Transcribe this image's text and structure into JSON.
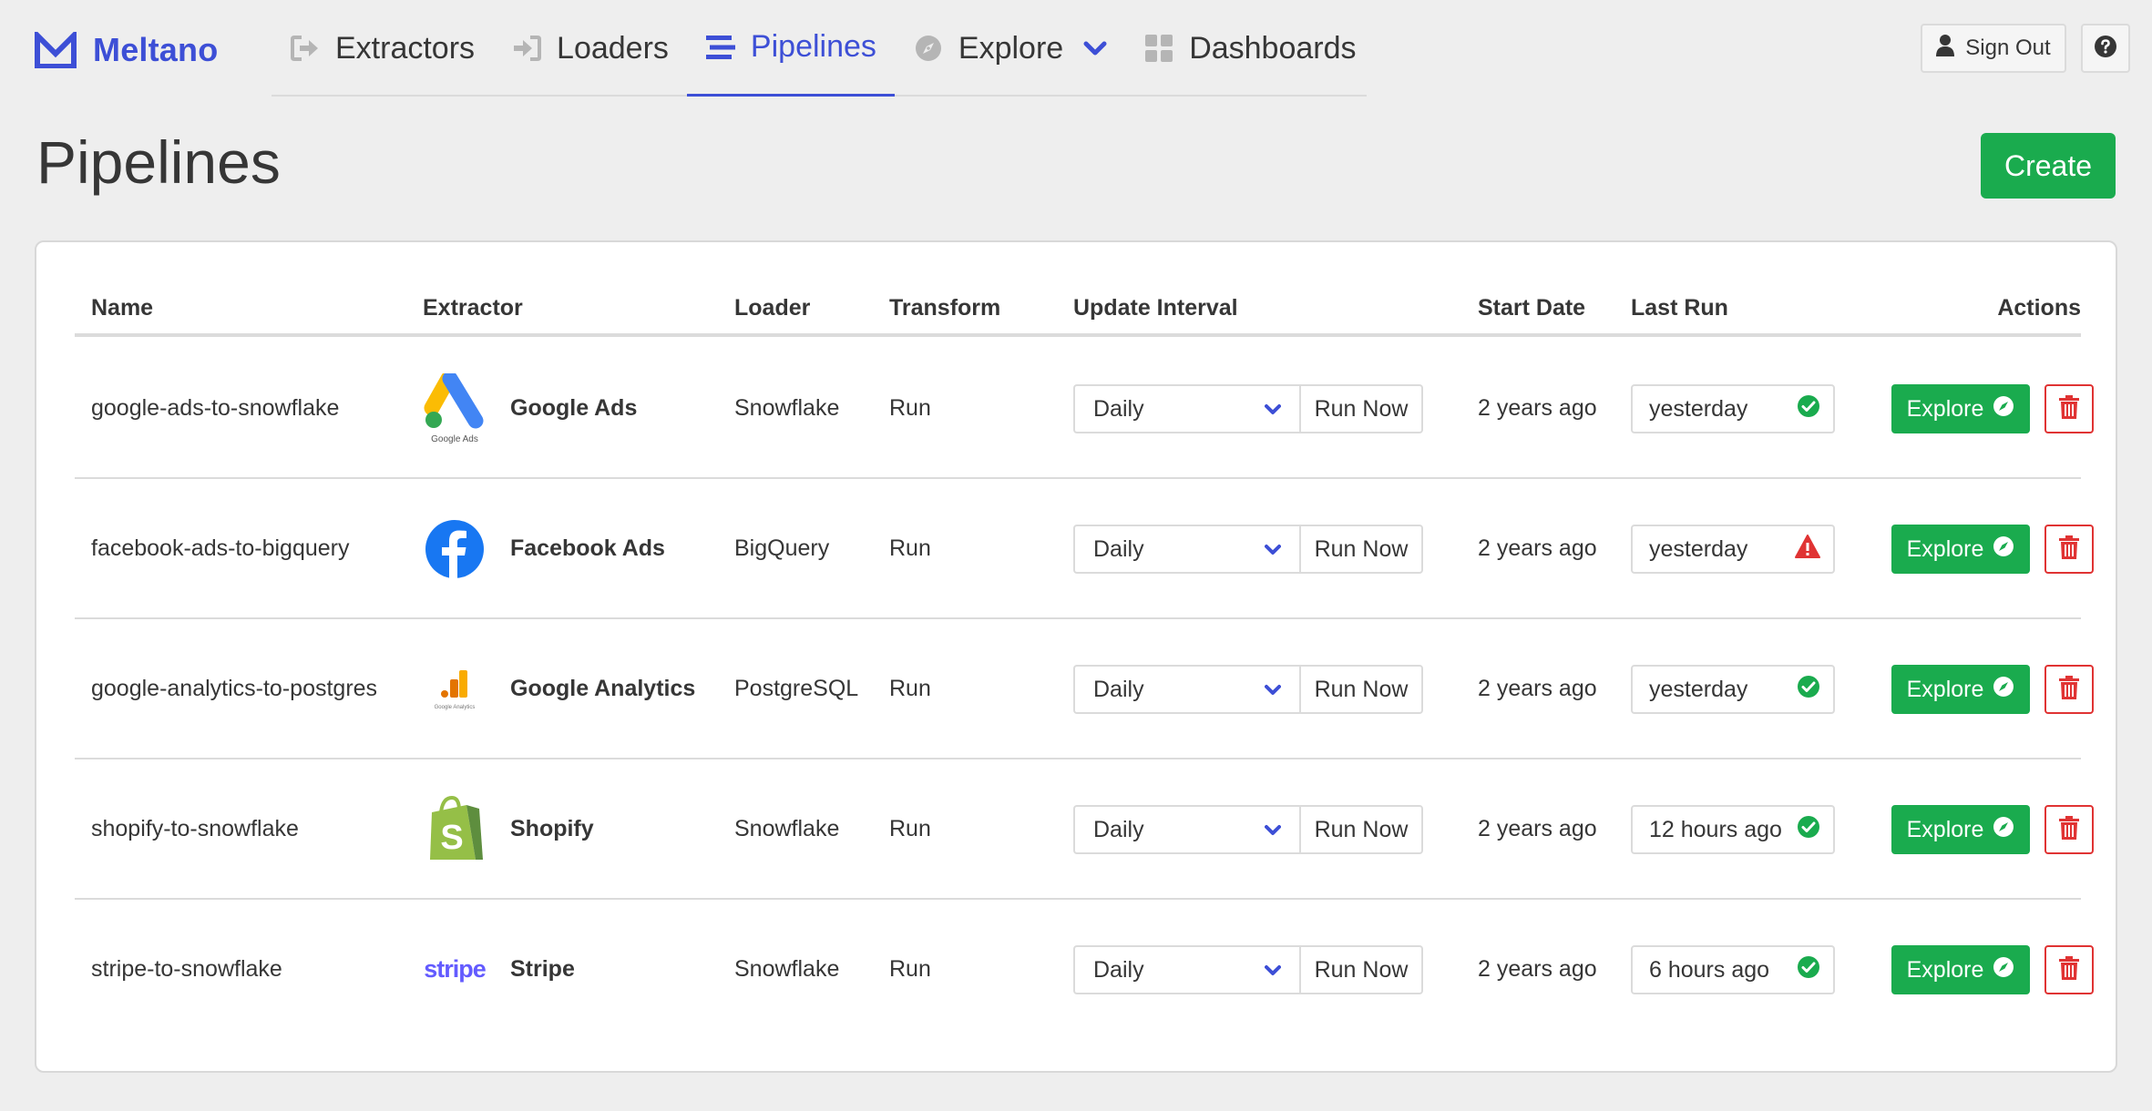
{
  "brand": {
    "name": "Meltano",
    "color": "#3d4fd6"
  },
  "nav": {
    "tabs": [
      {
        "label": "Extractors",
        "icon": "sign-out-icon"
      },
      {
        "label": "Loaders",
        "icon": "sign-in-icon"
      },
      {
        "label": "Pipelines",
        "icon": "stream-icon",
        "active": true
      },
      {
        "label": "Explore",
        "icon": "compass-icon"
      },
      {
        "label": "Dashboards",
        "icon": "th-large-icon"
      }
    ],
    "sign_out": "Sign Out",
    "help_icon": "question-circle-icon"
  },
  "header": {
    "title": "Pipelines",
    "create_label": "Create",
    "create_color": "#1aab4e"
  },
  "table": {
    "columns": [
      "Name",
      "Extractor",
      "Loader",
      "Transform",
      "Update Interval",
      "Start Date",
      "Last Run",
      "Actions"
    ],
    "rows": [
      {
        "name": "google-ads-to-snowflake",
        "extractor": "Google Ads",
        "extractor_logo": "google-ads-logo",
        "loader": "Snowflake",
        "transform": "Run",
        "interval": "Daily",
        "run_now": "Run Now",
        "start_date": "2 years ago",
        "last_run": "yesterday",
        "status": "success",
        "explore": "Explore"
      },
      {
        "name": "facebook-ads-to-bigquery",
        "extractor": "Facebook Ads",
        "extractor_logo": "facebook-logo",
        "loader": "BigQuery",
        "transform": "Run",
        "interval": "Daily",
        "run_now": "Run Now",
        "start_date": "2 years ago",
        "last_run": "yesterday",
        "status": "error",
        "explore": "Explore"
      },
      {
        "name": "google-analytics-to-postgres",
        "extractor": "Google Analytics",
        "extractor_logo": "google-analytics-logo",
        "loader": "PostgreSQL",
        "transform": "Run",
        "interval": "Daily",
        "run_now": "Run Now",
        "start_date": "2 years ago",
        "last_run": "yesterday",
        "status": "success",
        "explore": "Explore"
      },
      {
        "name": "shopify-to-snowflake",
        "extractor": "Shopify",
        "extractor_logo": "shopify-logo",
        "loader": "Snowflake",
        "transform": "Run",
        "interval": "Daily",
        "run_now": "Run Now",
        "start_date": "2 years ago",
        "last_run": "12 hours ago",
        "status": "success",
        "explore": "Explore"
      },
      {
        "name": "stripe-to-snowflake",
        "extractor": "Stripe",
        "extractor_logo": "stripe-logo",
        "loader": "Snowflake",
        "transform": "Run",
        "interval": "Daily",
        "run_now": "Run Now",
        "start_date": "2 years ago",
        "last_run": "6 hours ago",
        "status": "success",
        "explore": "Explore"
      }
    ],
    "logo_texts": {
      "google_ads": "Google Ads",
      "google_analytics": "Google Analytics",
      "stripe": "stripe"
    },
    "status_colors": {
      "success": "#1aab4e",
      "error": "#e03333"
    }
  }
}
